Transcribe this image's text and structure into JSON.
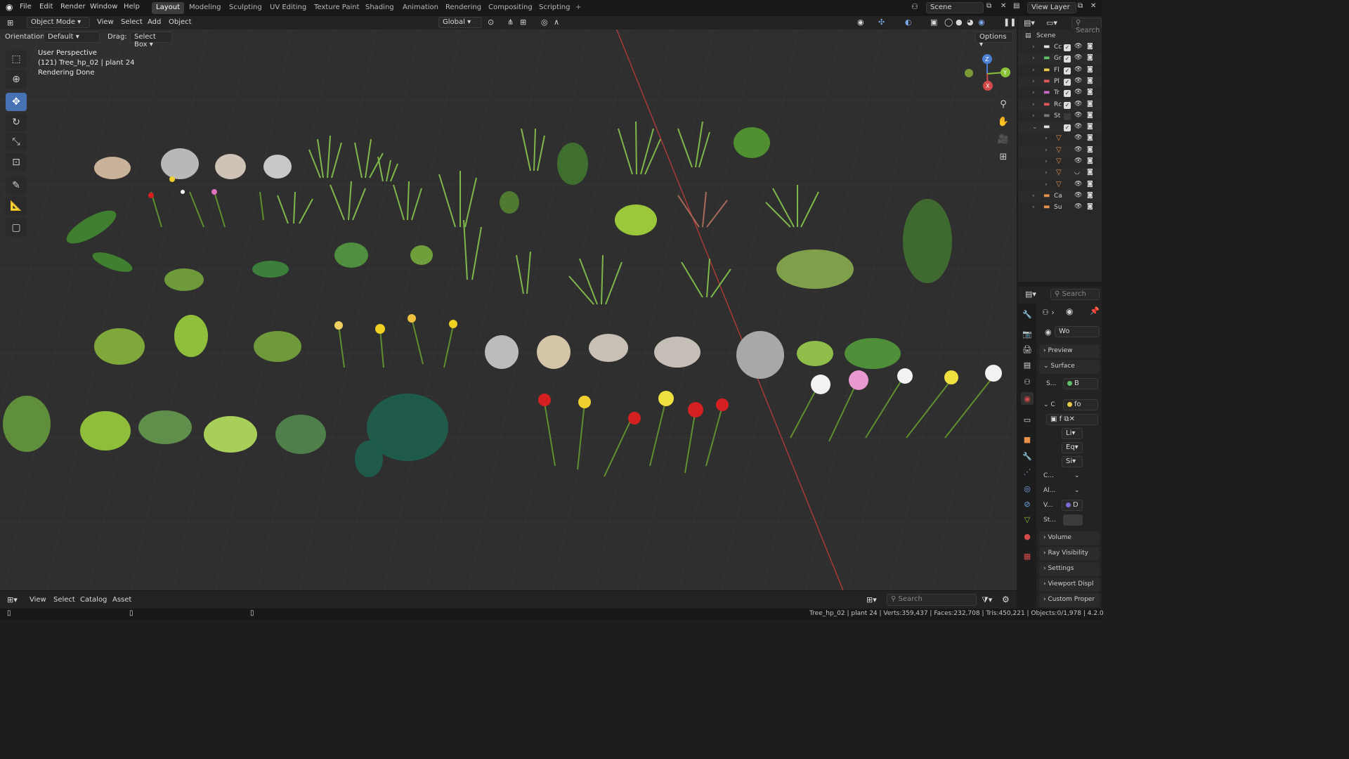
{
  "menu": {
    "file": "File",
    "edit": "Edit",
    "render": "Render",
    "window": "Window",
    "help": "Help"
  },
  "workspaces": [
    "Layout",
    "Modeling",
    "Sculpting",
    "UV Editing",
    "Texture Paint",
    "Shading",
    "Animation",
    "Rendering",
    "Compositing",
    "Scripting"
  ],
  "add_workspace": "+",
  "scene": {
    "name": "Scene",
    "view_layer": "View Layer"
  },
  "viewport_header": {
    "mode": "Object Mode",
    "view": "View",
    "select": "Select",
    "add": "Add",
    "object": "Object",
    "transform_orientation": "Global"
  },
  "tool_settings": {
    "orientation_label": "Orientation:",
    "orientation_value": "Default",
    "drag_label": "Drag:",
    "drag_value": "Select Box",
    "options": "Options"
  },
  "overlay_info": {
    "perspective": "User Perspective",
    "selection": "(121) Tree_hp_02 | plant 24",
    "status": "Rendering Done"
  },
  "gizmo": {
    "z": "Z",
    "y": "Y",
    "x": "X"
  },
  "asset_browser": {
    "view": "View",
    "select": "Select",
    "catalog": "Catalog",
    "asset": "Asset",
    "search_placeholder": "Search"
  },
  "status_bar": {
    "text": "Tree_hp_02 | plant 24 | Verts:359,437 | Faces:232,708 | Tris:450,221 | Objects:0/1,978 | 4.2.0"
  },
  "outliner": {
    "search_placeholder": "Search",
    "root": "Scene",
    "rows": [
      {
        "label": "Cc",
        "color": "#e0e0e0",
        "checked": true
      },
      {
        "label": "Gr",
        "color": "#5fbf6a",
        "checked": true
      },
      {
        "label": "Fl",
        "color": "#e8c84a",
        "checked": true
      },
      {
        "label": "Pl",
        "color": "#e05a5a",
        "checked": true
      },
      {
        "label": "Tr",
        "color": "#c96ac9",
        "checked": true
      },
      {
        "label": "Rc",
        "color": "#e05a5a",
        "checked": true
      },
      {
        "label": "St",
        "color": "#7a7a7a",
        "checked": false
      },
      {
        "label": "",
        "color": "#e0e0e0",
        "checked": true
      },
      {
        "label": "",
        "color": "#e8914a",
        "checked": null
      },
      {
        "label": "",
        "color": "#e8914a",
        "checked": null
      },
      {
        "label": "",
        "color": "#e8914a",
        "checked": null
      },
      {
        "label": "",
        "color": "#e8914a",
        "checked": null
      },
      {
        "label": "",
        "color": "#e8914a",
        "checked": null
      },
      {
        "label": "Ca",
        "color": "#e8914a",
        "checked": null
      },
      {
        "label": "Su",
        "color": "#e8914a",
        "checked": null
      }
    ]
  },
  "properties": {
    "search_placeholder": "Search",
    "world_name": "Wo",
    "panels": {
      "preview": "Preview",
      "surface": "Surface",
      "surface_shader_label": "S...",
      "surface_shader_value": "B",
      "color_label": "C",
      "color_value": "fo",
      "image_value": "f",
      "row_li": "Li",
      "row_eq": "Eq",
      "row_si": "Si",
      "row_c": "C...",
      "row_al": "Al...",
      "row_v": "V...",
      "row_v_value": "D",
      "row_st": "St...",
      "volume": "Volume",
      "ray_visibility": "Ray Visibility",
      "settings": "Settings",
      "viewport_display": "Viewport Displ",
      "custom_properties": "Custom Proper"
    }
  },
  "colors": {
    "accent": "#4772b3",
    "viewport": "#2f2f2f",
    "x_axis": "#d44a4a",
    "y_axis": "#8ac33a",
    "z_axis": "#4a7fd4"
  }
}
